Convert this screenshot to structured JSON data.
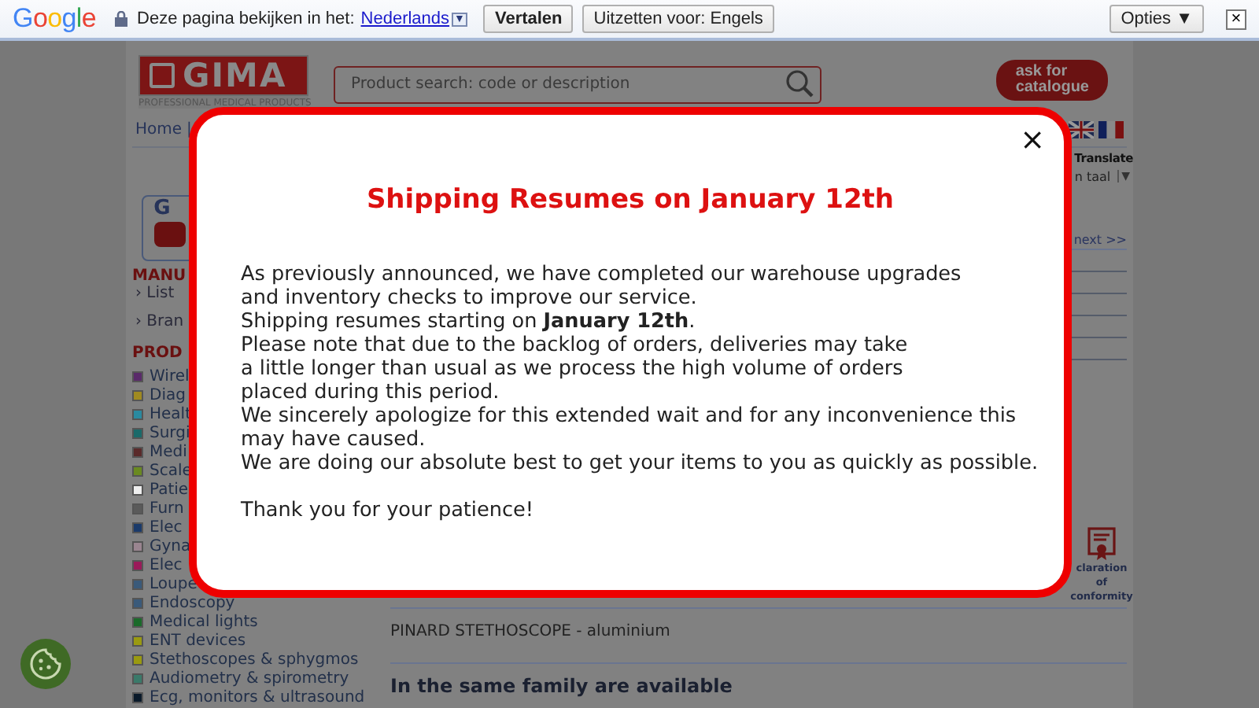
{
  "translate_bar": {
    "logo": "Google",
    "prompt": "Deze pagina bekijken in het:",
    "language": "Nederlands",
    "dropdown": "▼",
    "buttons": [
      "Vertalen",
      "Uitzetten voor: Engels"
    ],
    "options": "Opties ▼",
    "close": "×"
  },
  "header": {
    "logo": "GIMA",
    "tagline": "PROFESSIONAL MEDICAL PRODUCTS",
    "search": {
      "placeholder": "Product search: code or description"
    },
    "catalogue": [
      "ask for",
      "catalogue"
    ]
  },
  "nav": {
    "items": [
      "Home",
      "|"
    ],
    "translate": "Translate",
    "language_select": "n taal",
    "select_arrow": "▼"
  },
  "sidebar": {
    "video_letter": "G",
    "manuals_heading": "MANU",
    "manual_links": [
      "› List",
      "› Bran"
    ],
    "products_heading": "PROD",
    "categories": [
      {
        "label": "Wirel",
        "color": "#5a2a6a"
      },
      {
        "label": "Diag",
        "color": "#a08a20"
      },
      {
        "label": "Healt",
        "color": "#2a8aa0"
      },
      {
        "label": "Surgi",
        "color": "#1a6a6a"
      },
      {
        "label": "Medi",
        "color": "#5a2a2a"
      },
      {
        "label": "Scale",
        "color": "#6a8a20"
      },
      {
        "label": "Patie",
        "color": "#eeeeee"
      },
      {
        "label": "Furn",
        "color": "#5a5a5a"
      },
      {
        "label": "Elec",
        "color": "#1a3a6a"
      },
      {
        "label": "Gyna",
        "color": "#9a8590"
      },
      {
        "label": "Elec",
        "color": "#9a1a5a"
      },
      {
        "label": "Loupe",
        "color": "#3a5a7a"
      },
      {
        "label": "Endoscopy",
        "color": "#3a5a7a"
      },
      {
        "label": "Medical lights",
        "color": "#1a6a2a"
      },
      {
        "label": "ENT devices",
        "color": "#9a9a10"
      },
      {
        "label": "Stethoscopes & sphygmos",
        "color": "#9a9a10"
      },
      {
        "label": "Audiometry & spirometry",
        "color": "#3a7a6a"
      },
      {
        "label": "Ecg, monitors & ultrasound",
        "color": "#0a1a2a"
      }
    ]
  },
  "content": {
    "pager": "next >>",
    "declaration": [
      "claration",
      "of",
      "conformity"
    ],
    "product_name": "PINARD STETHOSCOPE - aluminium",
    "family_heading": "In the same family are available"
  },
  "modal": {
    "title": "Shipping Resumes on January 12th",
    "close": "×",
    "lines": [
      "As previously announced, we have completed our warehouse upgrades",
      "and inventory checks to improve our service.",
      "Shipping resumes starting on **January 12th**.",
      "Please note that due to the backlog of orders, deliveries may take",
      "a little longer than usual as we process the high volume of orders",
      "placed during this period.",
      "We sincerely apologize for this extended wait and for any inconvenience this",
      "may have caused.",
      "We are doing our absolute best to get your items to you as quickly as possible."
    ],
    "closing": "Thank you for your patience!"
  }
}
